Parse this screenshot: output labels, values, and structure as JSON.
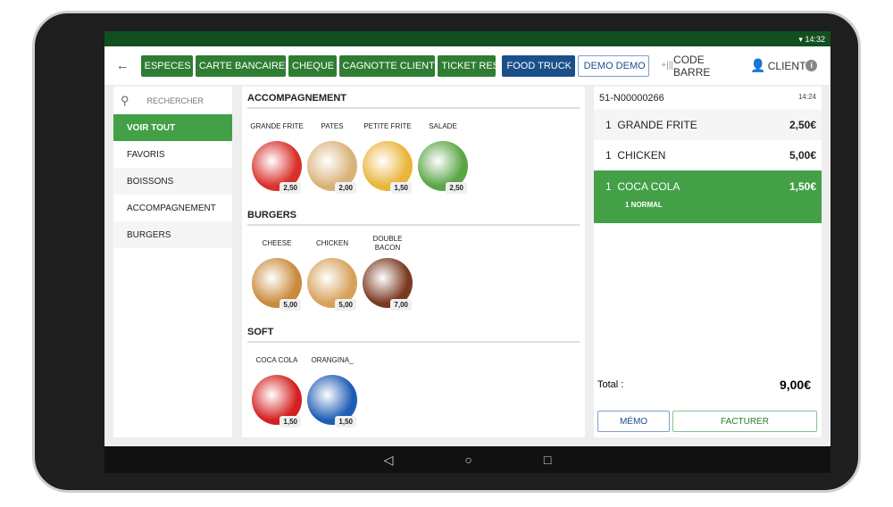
{
  "status": {
    "time": "14:32"
  },
  "toolbar": {
    "payments": [
      "ESPECES",
      "CARTE BANCAIRE",
      "CHEQUE",
      "CAGNOTTE CLIENT",
      "TICKET REST"
    ],
    "food_truck": "FOOD TRUCK",
    "demo": "DEMO DEMO",
    "barcode": "CODE BARRE",
    "client": "CLIENT"
  },
  "sidebar": {
    "search_placeholder": "RECHERCHER",
    "items": [
      "VOIR TOUT",
      "FAVORIS",
      "BOISSONS",
      "ACCOMPAGNEMENT",
      "BURGERS"
    ]
  },
  "catalog": [
    {
      "title": "ACCOMPAGNEMENT",
      "products": [
        {
          "name": "GRANDE FRITE",
          "price": "2,50",
          "color": "#d9302a"
        },
        {
          "name": "PATES",
          "price": "2,00",
          "color": "#d9b27a"
        },
        {
          "name": "PETITE FRITE",
          "price": "1,50",
          "color": "#e9b53a"
        },
        {
          "name": "SALADE",
          "price": "2,50",
          "color": "#5aa545"
        }
      ]
    },
    {
      "title": "BURGERS",
      "products": [
        {
          "name": "CHEESE",
          "price": "5,00",
          "color": "#c98b3c"
        },
        {
          "name": "CHICKEN",
          "price": "5,00",
          "color": "#d7a15a"
        },
        {
          "name": "DOUBLE BACON",
          "price": "7,00",
          "color": "#7a3a20"
        }
      ]
    },
    {
      "title": "SOFT",
      "products": [
        {
          "name": "COCA COLA",
          "price": "1,50",
          "color": "#d42020"
        },
        {
          "name": "ORANGINA_",
          "price": "1,50",
          "color": "#1f5db5"
        }
      ]
    }
  ],
  "order": {
    "number": "51-N00000266",
    "time": "14:24",
    "lines": [
      {
        "qty": "1",
        "name": "GRANDE FRITE",
        "price": "2,50€"
      },
      {
        "qty": "1",
        "name": "CHICKEN",
        "price": "5,00€"
      },
      {
        "qty": "1",
        "name": "COCA COLA",
        "price": "1,50€",
        "option": "1  NORMAL"
      }
    ],
    "total_label": "Total :",
    "total": "9,00€",
    "memo": "MÉMO",
    "invoice": "FACTURER"
  },
  "colors": {
    "primary": "#43a047",
    "status_bar": "#134f1e",
    "accent_blue": "#1a4f8a"
  }
}
